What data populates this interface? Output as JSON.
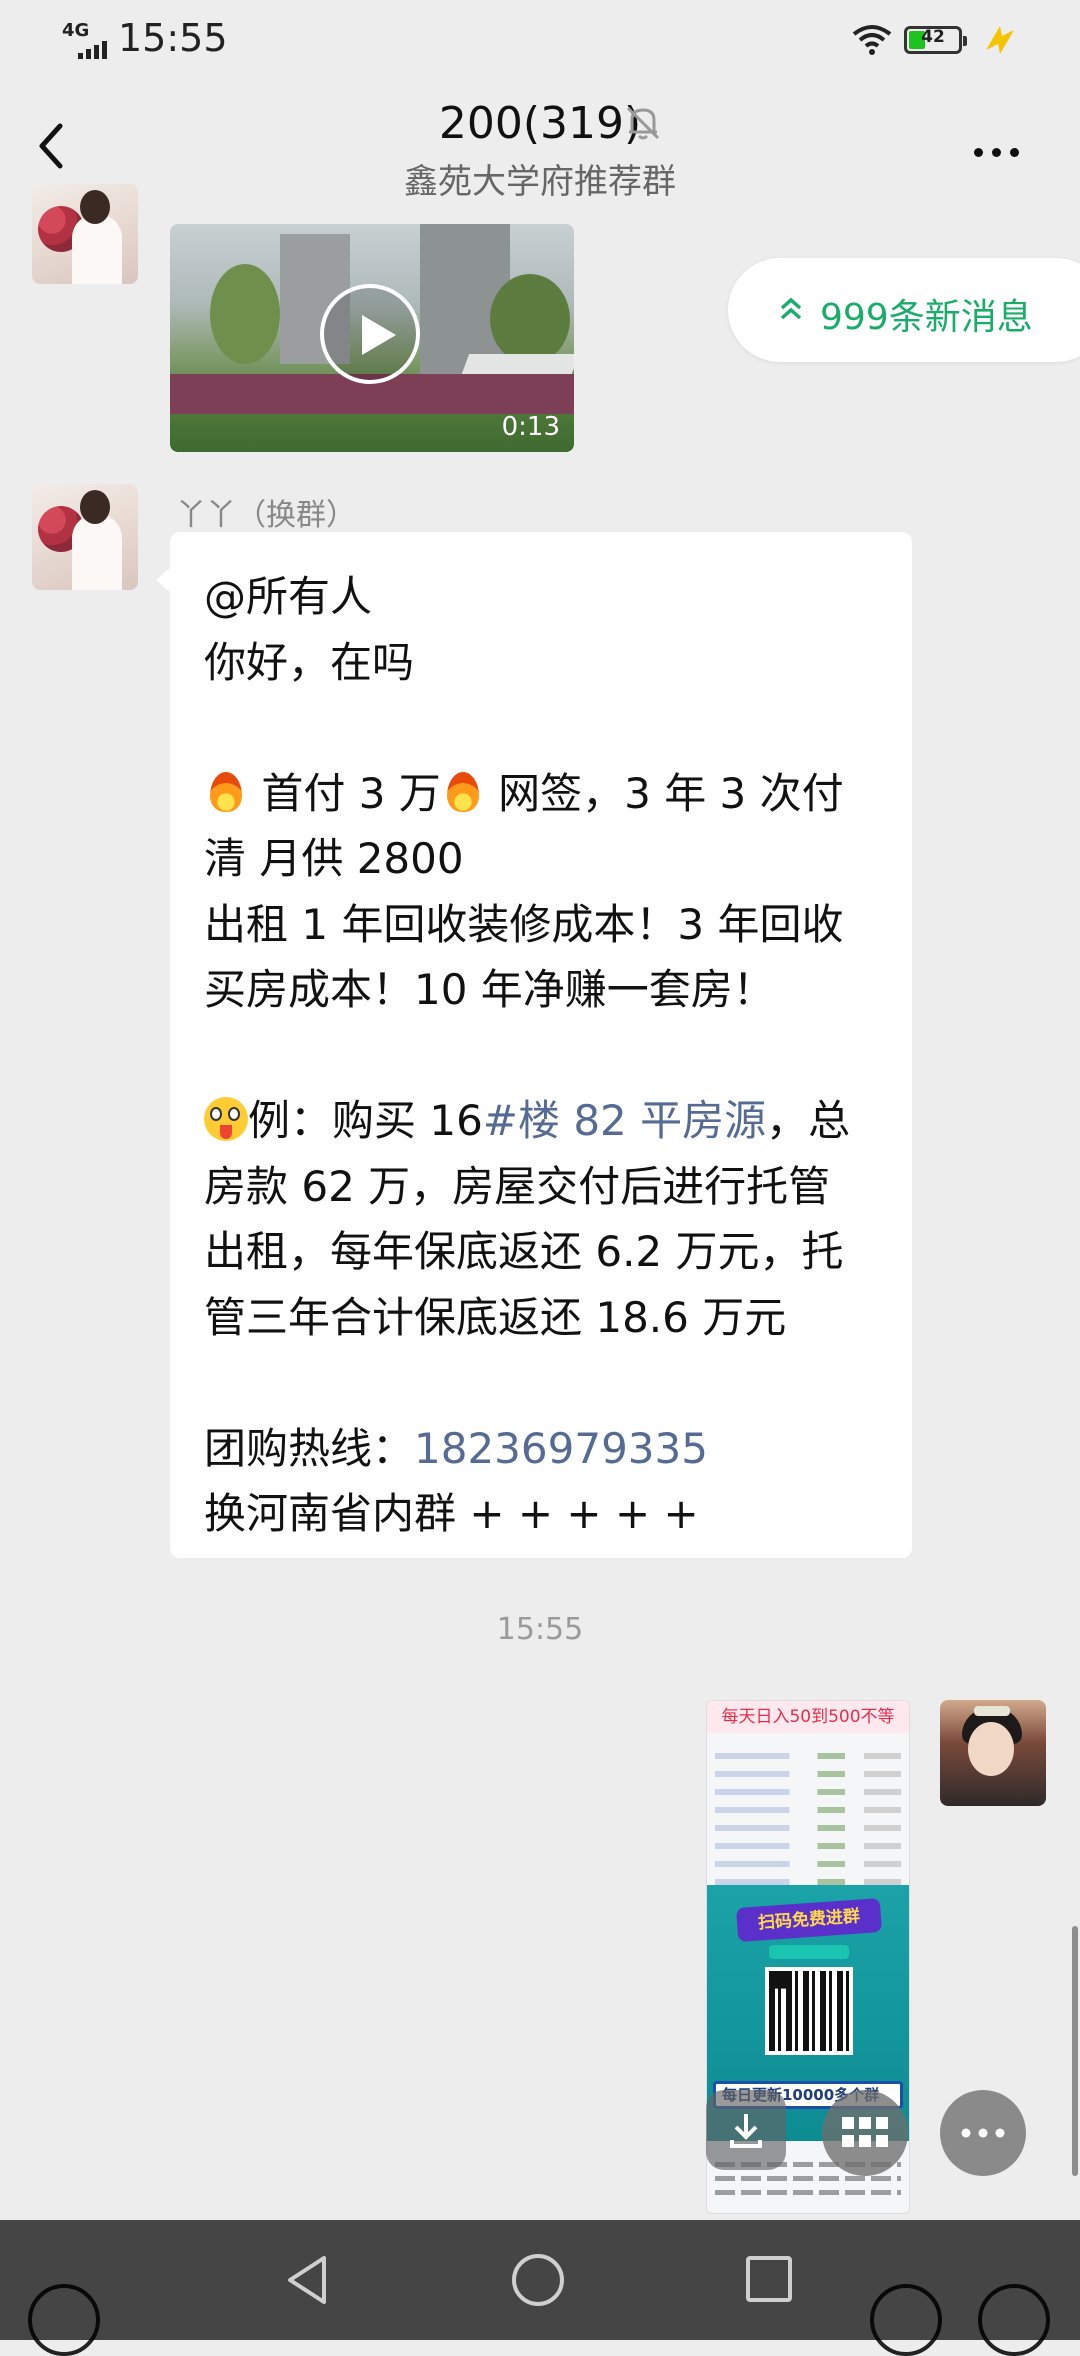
{
  "status_bar": {
    "network": "4G",
    "time": "15:55",
    "battery": "42"
  },
  "header": {
    "title": "200(319)",
    "subtitle": "鑫苑大学府推荐群"
  },
  "video_message": {
    "duration": "0:13"
  },
  "new_messages_pill": {
    "label": "999条新消息"
  },
  "text_message": {
    "sender": "丫丫（换群）",
    "lines": {
      "l1": "@所有人",
      "l2": "你好，在吗",
      "l3a": " 首付 3 万",
      "l3b": " 网签，3 年 3 次付",
      "l4": "清 月供 2800",
      "l5": "出租 1 年回收装修成本！3 年回收",
      "l6": "买房成本！10 年净赚一套房！",
      "l7a": "例：购买 16",
      "l7link": "#楼 82 平房源",
      "l7b": "，总",
      "l8": "房款 62 万，房屋交付后进行托管",
      "l9": "出租，每年保底返还 6.2 万元，托",
      "l10": "管三年合计保底返还 18.6 万元",
      "l11label": "团购热线：",
      "l11phone": "18236979335",
      "l12": "换河南省内群 + + + + +"
    }
  },
  "time_separator": "15:55",
  "image_message": {
    "header": "每天日入50到500不等",
    "banner": "扫码免费进群",
    "strip": "每日更新10000多个群"
  },
  "colors": {
    "accent_green": "#1aad6a",
    "link": "#566b93",
    "background": "#ededed"
  }
}
